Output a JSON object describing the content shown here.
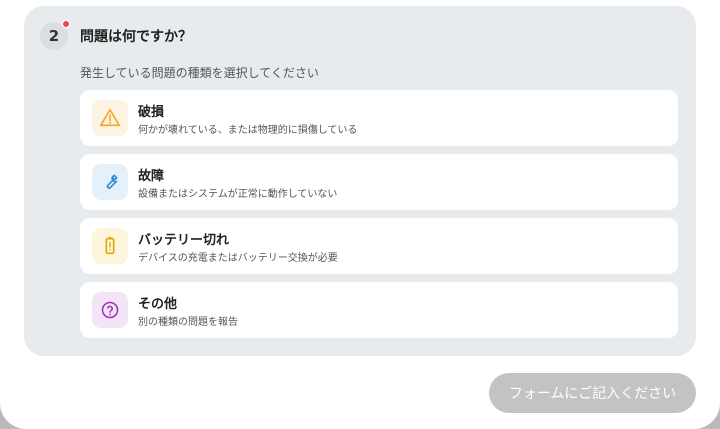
{
  "step": {
    "number": "2",
    "question": "問題は何ですか？",
    "hint": "発生している問題の種類を選択してください"
  },
  "options": [
    {
      "title": "破損",
      "desc": "何かが壊れている、または物理的に損傷している",
      "icon": "warning-icon",
      "color": "#f5a623",
      "bg": "#fdf3e3"
    },
    {
      "title": "故障",
      "desc": "設備またはシステムが正常に動作していない",
      "icon": "wrench-icon",
      "color": "#2b8fd6",
      "bg": "#e4f1fb"
    },
    {
      "title": "バッテリー切れ",
      "desc": "デバイスの充電またはバッテリー交換が必要",
      "icon": "battery-icon",
      "color": "#e0a800",
      "bg": "#fdf6dc"
    },
    {
      "title": "その他",
      "desc": "別の種類の問題を報告",
      "icon": "question-circle-icon",
      "color": "#9b30b8",
      "bg": "#f4e4f7"
    }
  ],
  "submit": {
    "label": "フォームにご記入ください"
  },
  "colors": {
    "badge_dot": "#e84848",
    "button_disabled": "#c2c3c4"
  }
}
